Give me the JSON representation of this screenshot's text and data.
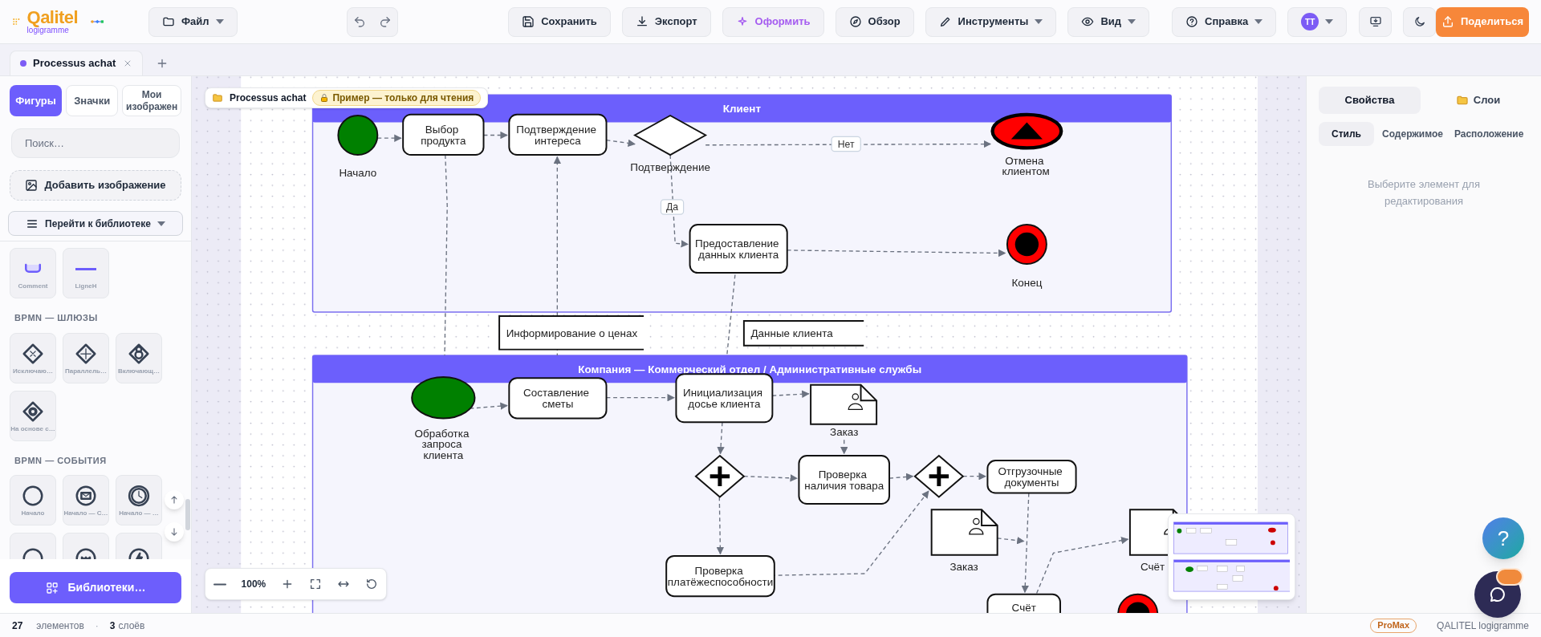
{
  "app": {
    "logo_name": "Qalitel",
    "logo_sub": "logigramme"
  },
  "toolbar": [
    {
      "label": "Файл",
      "dropdown": true
    },
    {
      "label": "Сохранить",
      "dropdown": false
    },
    {
      "label": "Экспорт",
      "dropdown": false
    },
    {
      "label": "Оформить",
      "dropdown": false
    },
    {
      "label": "Обзор",
      "dropdown": false
    },
    {
      "label": "Инструменты",
      "dropdown": true
    },
    {
      "label": "Вид",
      "dropdown": true
    },
    {
      "label": "Справка",
      "dropdown": true
    }
  ],
  "avatar": {
    "initials": "TT",
    "dropdown": true
  },
  "share_button": {
    "label": "Поделиться"
  },
  "tabs": [
    {
      "label": "Processus achat",
      "selected": true
    }
  ],
  "sidebar": {
    "tabs": [
      {
        "label": "Фигуры",
        "selected": true
      },
      {
        "label": "Значки",
        "selected": false
      },
      {
        "label": "Мои изображен",
        "selected": false
      }
    ],
    "search": {
      "placeholder": "Поиск…"
    },
    "add_image": "Добавить изображение",
    "library_select": "Перейти к библиотеке",
    "groups": [
      {
        "tiles": [
          {
            "kind": "comment",
            "label": "Comment"
          },
          {
            "kind": "line",
            "label": "LigneH"
          }
        ]
      },
      {
        "title": "BPMN — ШЛЮЗЫ",
        "tiles": [
          {
            "kind": "gw_exclusive",
            "label": "Исключаю…"
          },
          {
            "kind": "gw_parallel",
            "label": "Параллель…"
          },
          {
            "kind": "gw_inclusive",
            "label": "Включающ…"
          },
          {
            "kind": "gw_event",
            "label": "На основе с…"
          }
        ]
      },
      {
        "title": "BPMN — СОБЫТИЯ",
        "tiles": [
          {
            "kind": "start",
            "label": "Начало"
          },
          {
            "kind": "start_message",
            "label": "Начало — С…"
          },
          {
            "kind": "start_timer",
            "label": "Начало — …"
          },
          {
            "kind": "event_thick"
          },
          {
            "kind": "event_ribbon"
          },
          {
            "kind": "event_signal"
          }
        ]
      }
    ],
    "libraries_button": "Библиотеки…"
  },
  "canvas": {
    "breadcrumb": "Processus achat",
    "readonly_badge": "Пример — только для чтения",
    "zoom": "100%",
    "pools": [
      {
        "title": "Клиент"
      },
      {
        "title": "Компания — Коммерческий отдел / Административные службы"
      }
    ],
    "nodes": [
      {
        "kind": "start",
        "label": "Начало"
      },
      {
        "kind": "task",
        "label": "Выбор продукта"
      },
      {
        "kind": "task",
        "label": "Подтверждение интереса"
      },
      {
        "kind": "gateway_exclusive",
        "label": "Подтверждение"
      },
      {
        "kind": "end_cancel",
        "label": "Отмена клиентом"
      },
      {
        "kind": "task",
        "label": "Предоставление данных клиента"
      },
      {
        "kind": "end",
        "label": "Конец"
      },
      {
        "kind": "annotation",
        "label": "Информирование о ценах"
      },
      {
        "kind": "annotation",
        "label": "Данные клиента"
      },
      {
        "kind": "start",
        "label": "Обработка запроса клиента"
      },
      {
        "kind": "task",
        "label": "Составление сметы"
      },
      {
        "kind": "task",
        "label": "Инициализация досье клиента"
      },
      {
        "kind": "document",
        "label": "Заказ"
      },
      {
        "kind": "gateway_parallel"
      },
      {
        "kind": "task",
        "label": "Проверка наличия товара"
      },
      {
        "kind": "gateway_parallel"
      },
      {
        "kind": "task",
        "label": "Отгрузочные документы"
      },
      {
        "kind": "document",
        "label": "Заказ"
      },
      {
        "kind": "document",
        "label": "Счёт"
      },
      {
        "kind": "task",
        "label": "Проверка платёжеспособности"
      },
      {
        "kind": "task",
        "label": "Счёт"
      },
      {
        "kind": "end"
      }
    ],
    "edge_labels": [
      "Нет",
      "Да"
    ]
  },
  "right_panel": {
    "tabs": [
      {
        "label": "Свойства",
        "selected": true
      },
      {
        "label": "Слои",
        "selected": false
      }
    ],
    "subtabs": [
      {
        "label": "Стиль",
        "selected": true
      },
      {
        "label": "Содержимое",
        "selected": false
      },
      {
        "label": "Расположение",
        "selected": false
      }
    ],
    "hint": "Выберите элемент для редактирования"
  },
  "help_button": "?",
  "status_bar": {
    "elements_count": "27",
    "elements_label": "элементов",
    "separator": "·",
    "layers_count": "3",
    "layers_label": "слоёв",
    "plan": "ProMax",
    "product": "QALITEL logigramme"
  }
}
